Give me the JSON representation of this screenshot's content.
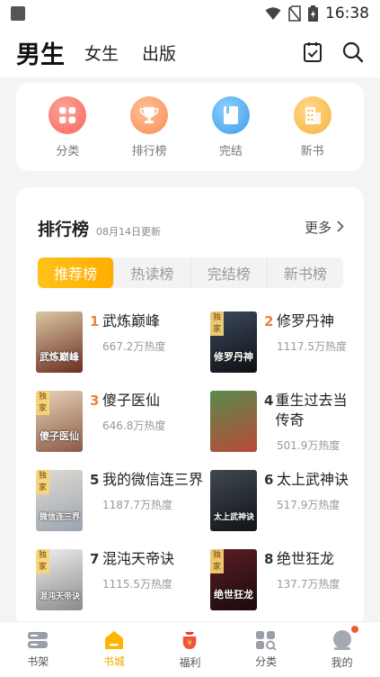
{
  "status_bar": {
    "time": "16:38"
  },
  "top_nav": {
    "tabs": [
      {
        "label": "男生",
        "active": true
      },
      {
        "label": "女生",
        "active": false
      },
      {
        "label": "出版",
        "active": false
      }
    ],
    "icons": [
      "checklist-icon",
      "search-icon"
    ]
  },
  "shortcuts": [
    {
      "label": "分类",
      "icon": "grid-icon",
      "color": "#f86f63"
    },
    {
      "label": "排行榜",
      "icon": "trophy-icon",
      "color": "#f9965a"
    },
    {
      "label": "完结",
      "icon": "book-icon",
      "color": "#4aa8ef"
    },
    {
      "label": "新书",
      "icon": "building-icon",
      "color": "#f8b84c"
    }
  ],
  "ranking": {
    "title": "排行榜",
    "update_text": "08月14日更新",
    "more_label": "更多",
    "tabs": [
      {
        "label": "推荐榜",
        "active": true
      },
      {
        "label": "热读榜",
        "active": false
      },
      {
        "label": "完结榜",
        "active": false
      },
      {
        "label": "新书榜",
        "active": false
      }
    ],
    "books": [
      {
        "rank": "1",
        "name": "武炼巅峰",
        "heat": "667.2万热度",
        "exclusive": false,
        "cover_title": "武炼巅峰",
        "cover_colors": [
          "#d9c7a4",
          "#6b2e1f"
        ]
      },
      {
        "rank": "2",
        "name": "修罗丹神",
        "heat": "1117.5万热度",
        "exclusive": true,
        "cover_title": "修罗丹神",
        "cover_colors": [
          "#3c4a5c",
          "#0f0f14"
        ]
      },
      {
        "rank": "3",
        "name": "傻子医仙",
        "heat": "646.8万热度",
        "exclusive": true,
        "cover_title": "傻子医仙",
        "cover_colors": [
          "#e9d2b8",
          "#8a5a45"
        ]
      },
      {
        "rank": "4",
        "name": "重生过去当传奇",
        "heat": "501.9万热度",
        "exclusive": false,
        "cover_title": "",
        "cover_colors": [
          "#5a8a4a",
          "#b84a3a"
        ]
      },
      {
        "rank": "5",
        "name": "我的微信连三界",
        "heat": "1187.7万热度",
        "exclusive": true,
        "cover_title": "微信连三界",
        "cover_colors": [
          "#e0dcd4",
          "#9aa3b0"
        ]
      },
      {
        "rank": "6",
        "name": "太上武神诀",
        "heat": "517.9万热度",
        "exclusive": false,
        "cover_title": "太上武神诀",
        "cover_colors": [
          "#404850",
          "#111418"
        ]
      },
      {
        "rank": "7",
        "name": "混沌天帝诀",
        "heat": "1115.5万热度",
        "exclusive": true,
        "cover_title": "混沌天帝诀",
        "cover_colors": [
          "#efefef",
          "#8a8a8a"
        ]
      },
      {
        "rank": "8",
        "name": "绝世狂龙",
        "heat": "137.7万热度",
        "exclusive": true,
        "cover_title": "绝世狂龙",
        "cover_colors": [
          "#5a1e24",
          "#1a0a0c"
        ]
      }
    ]
  },
  "bottom_nav": [
    {
      "label": "书架",
      "icon": "bookshelf-icon",
      "active": false
    },
    {
      "label": "书城",
      "icon": "bookstore-icon",
      "active": true
    },
    {
      "label": "福利",
      "icon": "gift-bag-icon",
      "active": false
    },
    {
      "label": "分类",
      "icon": "category-icon",
      "active": false
    },
    {
      "label": "我的",
      "icon": "profile-icon",
      "active": false,
      "badge": true
    }
  ],
  "colors": {
    "accent": "#ffb400",
    "rank_top": "#f0803c"
  }
}
